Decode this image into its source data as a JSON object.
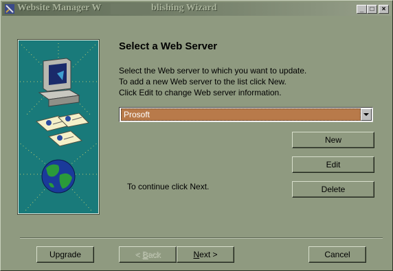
{
  "window": {
    "title_left": "Website Manager W",
    "title_right": "blishing Wizard",
    "min_label": "_",
    "max_label": "□",
    "close_label": "×"
  },
  "page": {
    "heading": "Select a Web Server",
    "line1": "Select the Web server to which you want to update.",
    "line2": "To add a new Web server to the list click New.",
    "line3": "Click Edit to change Web server information.",
    "continue_text": "To continue click Next."
  },
  "server_select": {
    "value": "Prosoft"
  },
  "buttons": {
    "new": "New",
    "edit": "Edit",
    "delete": "Delete",
    "upgrade": "Upgrade",
    "back_mnemonic": "B",
    "back_rest": "ack",
    "back_prefix": "< ",
    "next_mnemonic": "N",
    "next_rest": "ext",
    "next_suffix": " >",
    "cancel": "Cancel"
  },
  "colors": {
    "dialog_bg": "#8f9a80",
    "art_bg": "#197a7a",
    "selection": "#b87a4a"
  },
  "icons": [
    "app-icon",
    "computer-icon",
    "documents-icon",
    "globe-icon",
    "dropdown-arrow-icon"
  ]
}
